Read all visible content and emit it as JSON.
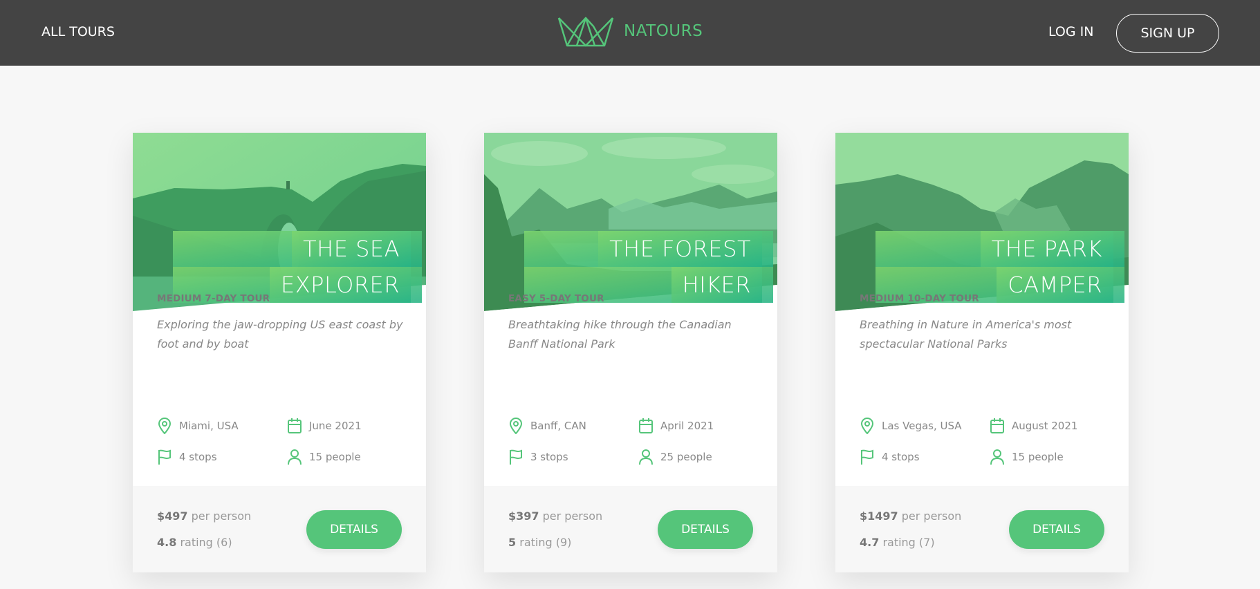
{
  "nav": {
    "all_tours": "ALL TOURS",
    "brand": "NATOURS",
    "login": "LOG IN",
    "signup": "SIGN UP"
  },
  "colors": {
    "header_bg": "#444444",
    "accent": "#55c57a",
    "page_bg": "#f7f7f7"
  },
  "tours": [
    {
      "title_line1": "THE SEA",
      "title_line2": "EXPLORER",
      "difficulty": "MEDIUM 7-DAY TOUR",
      "summary": "Exploring the jaw-dropping US east coast by foot and by boat",
      "location": "Miami, USA",
      "date": "June 2021",
      "stops": "4 stops",
      "people": "15 people",
      "price": "$497",
      "price_suffix": "per person",
      "rating": "4.8",
      "rating_suffix": "rating (6)",
      "button": "DETAILS"
    },
    {
      "title_line1": "THE FOREST",
      "title_line2": "HIKER",
      "difficulty": "EASY 5-DAY TOUR",
      "summary": "Breathtaking hike through the Canadian Banff National Park",
      "location": "Banff, CAN",
      "date": "April 2021",
      "stops": "3 stops",
      "people": "25 people",
      "price": "$397",
      "price_suffix": "per person",
      "rating": "5",
      "rating_suffix": "rating (9)",
      "button": "DETAILS"
    },
    {
      "title_line1": "THE PARK",
      "title_line2": "CAMPER",
      "difficulty": "MEDIUM 10-DAY TOUR",
      "summary": "Breathing in Nature in America's most spectacular National Parks",
      "location": "Las Vegas, USA",
      "date": "August 2021",
      "stops": "4 stops",
      "people": "15 people",
      "price": "$1497",
      "price_suffix": "per person",
      "rating": "4.7",
      "rating_suffix": "rating (7)",
      "button": "DETAILS"
    }
  ]
}
